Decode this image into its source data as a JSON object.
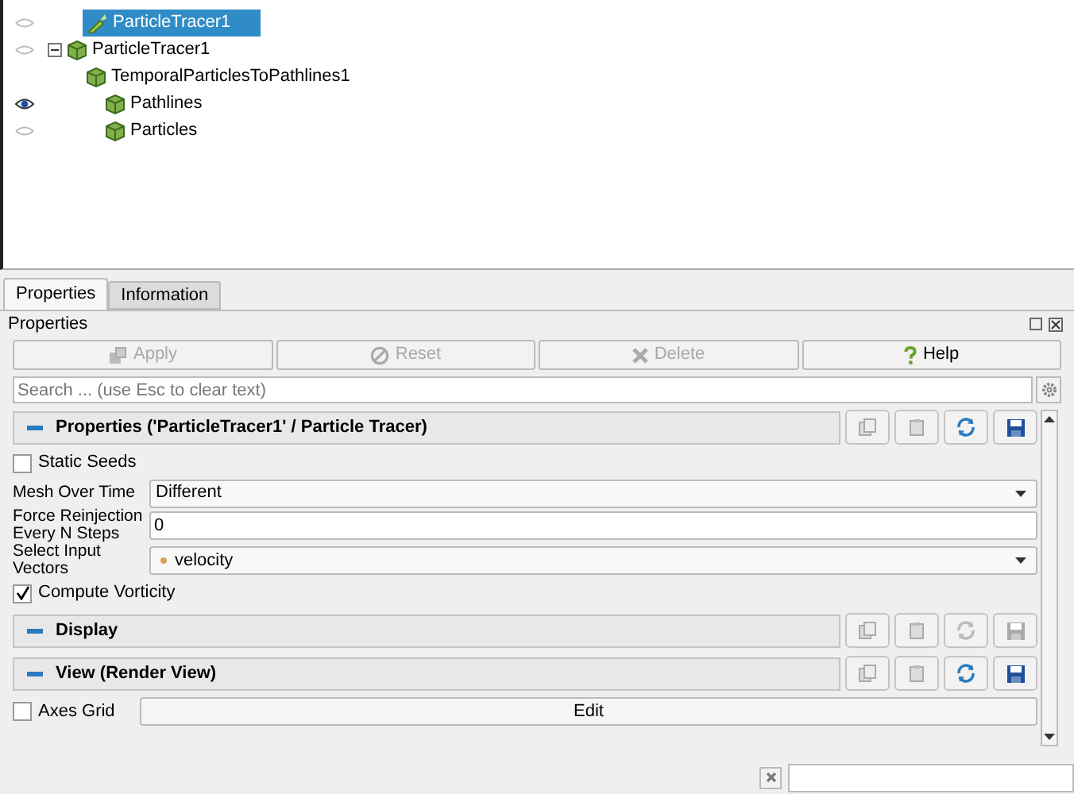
{
  "pipeline": {
    "items": [
      {
        "label": "ParticleTracer1",
        "kind": "filter",
        "selected": true,
        "visible": false
      },
      {
        "label": "ParticleTracer1",
        "kind": "dataset",
        "selected": false,
        "visible": false,
        "expanded": true,
        "children": [
          {
            "label": "TemporalParticlesToPathlines1",
            "kind": "dataset",
            "selected": false,
            "children": [
              {
                "label": "Pathlines",
                "kind": "dataset",
                "selected": false,
                "visible": true
              },
              {
                "label": "Particles",
                "kind": "dataset",
                "selected": false,
                "visible": false
              }
            ]
          }
        ]
      }
    ]
  },
  "tabs": [
    {
      "label": "Properties",
      "selected": true
    },
    {
      "label": "Information",
      "selected": false
    }
  ],
  "panel_title": "Properties",
  "actions": [
    {
      "label": "Apply",
      "kind": "apply",
      "disabled": true
    },
    {
      "label": "Reset",
      "kind": "reset",
      "disabled": true
    },
    {
      "label": "Delete",
      "kind": "delete",
      "disabled": true
    },
    {
      "label": "Help",
      "kind": "help",
      "disabled": false
    }
  ],
  "search": {
    "placeholder": "Search ... (use Esc to clear text)"
  },
  "sections": [
    {
      "title": "Properties ('ParticleTracer1' / Particle Tracer)",
      "active": true,
      "rows": [
        {
          "kind": "checkbox",
          "label": "Static Seeds",
          "checked": false
        },
        {
          "kind": "dropdown",
          "label": "Mesh Over Time",
          "value": "Different"
        },
        {
          "kind": "text",
          "label": "Force Reinjection Every N Steps",
          "value": "0"
        },
        {
          "kind": "dropdown",
          "label": "Select Input Vectors",
          "value": "velocity",
          "dot": true
        },
        {
          "kind": "checkbox",
          "label": "Compute Vorticity",
          "checked": true
        }
      ]
    },
    {
      "title": "Display",
      "active": false
    },
    {
      "title": "View (Render View)",
      "active": true,
      "rows": [
        {
          "kind": "checkbox_button",
          "label": "Axes Grid",
          "checked": false,
          "button": "Edit"
        }
      ]
    }
  ]
}
